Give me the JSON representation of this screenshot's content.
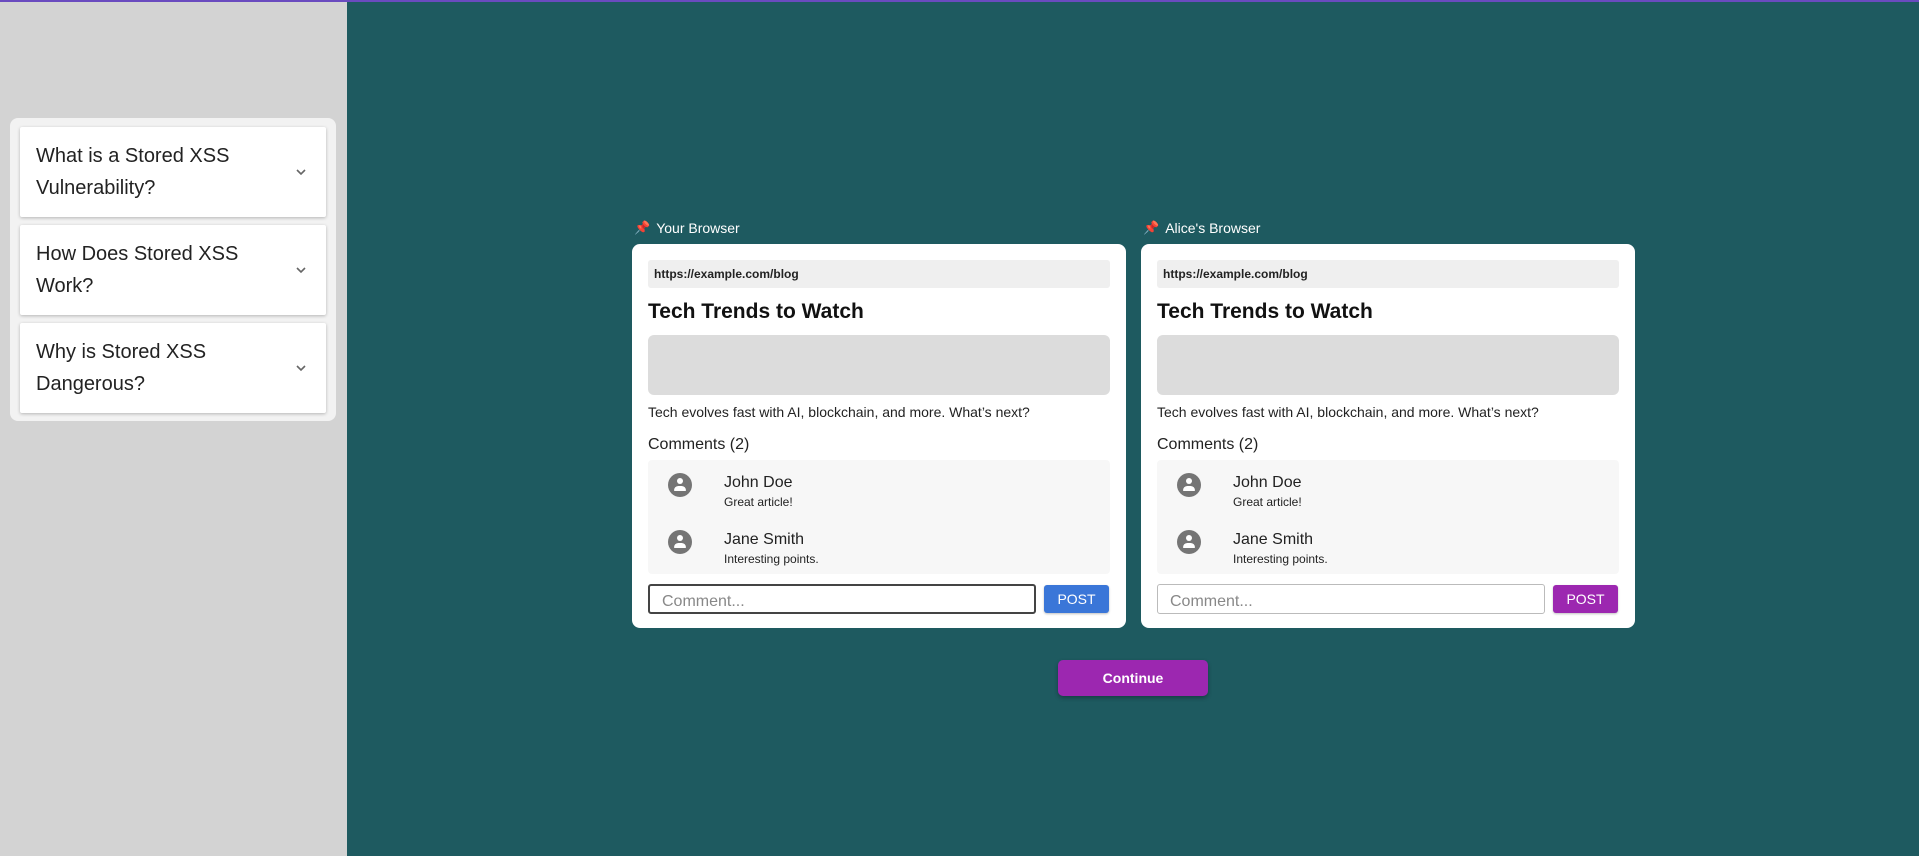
{
  "colors": {
    "main_bg": "#1e5a60",
    "sidebar_bg": "#d3d3d3",
    "post_blue": "#3a76d8",
    "accent_purple": "#9c27b0"
  },
  "faq": {
    "items": [
      {
        "question": "What is a Stored XSS Vulnerability?",
        "icon": "chevron-down-icon"
      },
      {
        "question": "How Does Stored XSS Work?",
        "icon": "chevron-down-icon"
      },
      {
        "question": "Why is Stored XSS Dangerous?",
        "icon": "chevron-down-icon"
      }
    ]
  },
  "browsers": [
    {
      "label": "Your Browser",
      "pin_icon": "pushpin-icon",
      "url": "https://example.com/blog",
      "title": "Tech Trends to Watch",
      "description": "Tech evolves fast with AI, blockchain, and more. What’s next?",
      "comments_heading": "Comments (2)",
      "comments": [
        {
          "name": "John Doe",
          "text": "Great article!"
        },
        {
          "name": "Jane Smith",
          "text": "Interesting points."
        }
      ],
      "input_placeholder": "Comment...",
      "post_label": "POST"
    },
    {
      "label": "Alice's Browser",
      "pin_icon": "pushpin-icon",
      "url": "https://example.com/blog",
      "title": "Tech Trends to Watch",
      "description": "Tech evolves fast with AI, blockchain, and more. What’s next?",
      "comments_heading": "Comments (2)",
      "comments": [
        {
          "name": "John Doe",
          "text": "Great article!"
        },
        {
          "name": "Jane Smith",
          "text": "Interesting points."
        }
      ],
      "input_placeholder": "Comment...",
      "post_label": "POST"
    }
  ],
  "continue_label": "Continue"
}
